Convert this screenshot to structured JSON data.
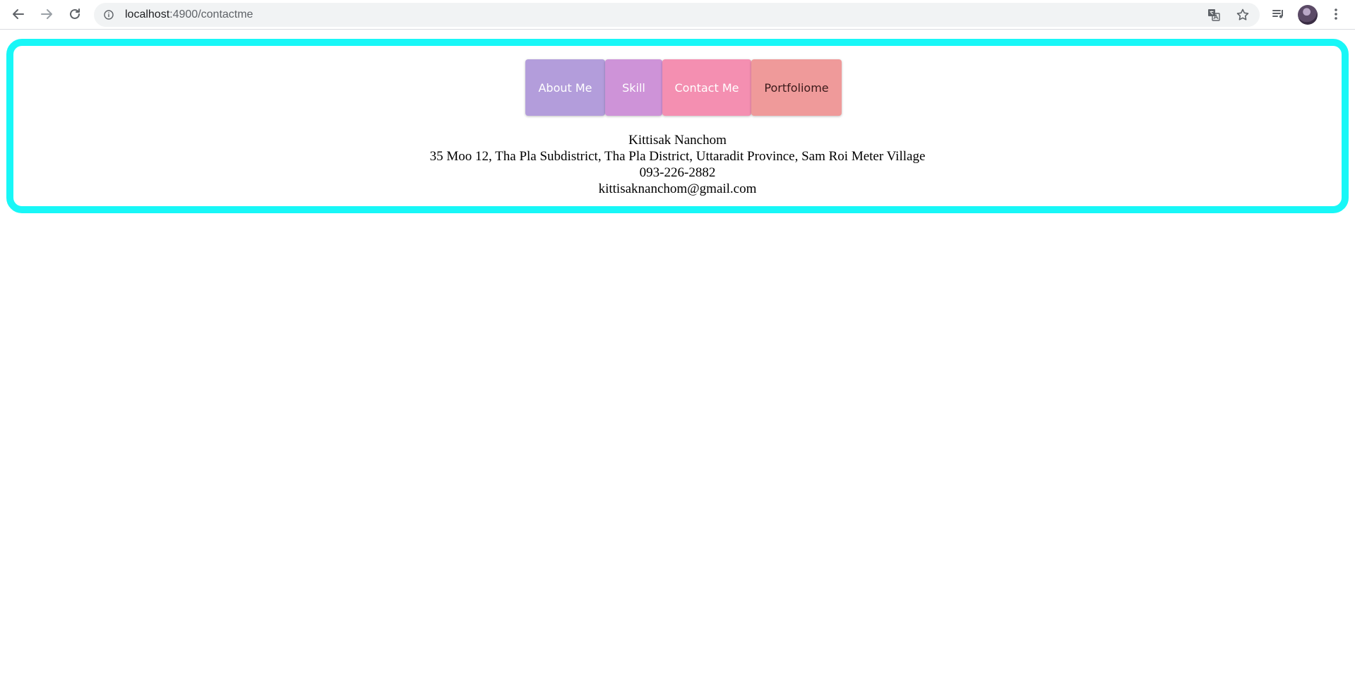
{
  "browser": {
    "url_host": "localhost",
    "url_rest": ":4900/contactme",
    "icons": {
      "back": "back-arrow-icon",
      "forward": "forward-arrow-icon",
      "reload": "reload-icon",
      "info": "info-icon",
      "translate": "translate-icon",
      "bookmark": "star-icon",
      "media": "media-queue-icon",
      "menu": "kebab-menu-icon"
    }
  },
  "nav": {
    "items": [
      {
        "label": "About Me",
        "color": "#b39ddb"
      },
      {
        "label": "Skill",
        "color": "#ce93d8"
      },
      {
        "label": "Contact Me",
        "color": "#f48fb1"
      },
      {
        "label": "Portfoliome",
        "color": "#ef9a9a"
      }
    ]
  },
  "contact": {
    "name": "Kittisak Nanchom",
    "address": "35 Moo 12, Tha Pla Subdistrict, Tha Pla District, Uttaradit Province, Sam Roi Meter Village",
    "phone": "093-226-2882",
    "email": "kittisaknanchom@gmail.com"
  },
  "theme": {
    "frame_border": "#18f7f7"
  }
}
